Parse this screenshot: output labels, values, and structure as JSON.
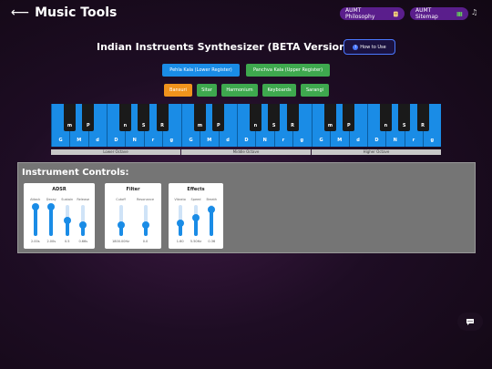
{
  "header": {
    "back_arrow": "⟵",
    "title": "Music Tools",
    "philosophy_label": "AUMT Philosophy",
    "philosophy_icon": "scroll-icon",
    "sitemap_label": "AUMT Sitemap",
    "sitemap_icon": "map-icon",
    "music_icon": "♫"
  },
  "page": {
    "heading": "Indian Instruents Synthesizer (BETA Version)",
    "how_to_label": "How to Use",
    "how_to_icon": "?"
  },
  "registers": [
    {
      "label": "Pehla Kala (Lower Register)",
      "color": "#1a8ce6"
    },
    {
      "label": "Panchva Kala (Upper Register)",
      "color": "#3ea84e"
    }
  ],
  "instruments": [
    {
      "label": "Bansuri",
      "selected": true
    },
    {
      "label": "Sitar",
      "selected": false
    },
    {
      "label": "Harmonium",
      "selected": false
    },
    {
      "label": "Keyboards",
      "selected": false
    },
    {
      "label": "Sarangi",
      "selected": false
    }
  ],
  "keyboard": {
    "octaves": [
      {
        "label": "Lower Octave"
      },
      {
        "label": "Middle Octave"
      },
      {
        "label": "Higher Octave"
      }
    ],
    "white_notes": [
      "G",
      "M",
      "d",
      "D",
      "N",
      "r",
      "g"
    ],
    "black_notes": [
      "m",
      "P",
      "n",
      "S",
      "R"
    ]
  },
  "controls": {
    "title": "Instrument Controls:",
    "groups": [
      {
        "title": "ADSR",
        "knobs": [
          {
            "label": "Attack",
            "value": "2.00s",
            "level": 0.95
          },
          {
            "label": "Decay",
            "value": "2.00s",
            "level": 0.95
          },
          {
            "label": "Sustain",
            "value": "0.5",
            "level": 0.5
          },
          {
            "label": "Release",
            "value": "0.66s",
            "level": 0.35
          }
        ]
      },
      {
        "title": "Filter",
        "knobs": [
          {
            "label": "Cutoff",
            "value": "1800.00Hz",
            "level": 0.35
          },
          {
            "label": "Resonance",
            "value": "0.0",
            "level": 0.35
          }
        ]
      },
      {
        "title": "Effects",
        "knobs": [
          {
            "label": "Vibrato",
            "value": "1.60",
            "level": 0.4
          },
          {
            "label": "Speed",
            "value": "5.50Hz",
            "level": 0.6
          },
          {
            "label": "Breath",
            "value": "0.36",
            "level": 0.85
          }
        ]
      }
    ]
  },
  "chat_icon": "chat-bubble-icon"
}
